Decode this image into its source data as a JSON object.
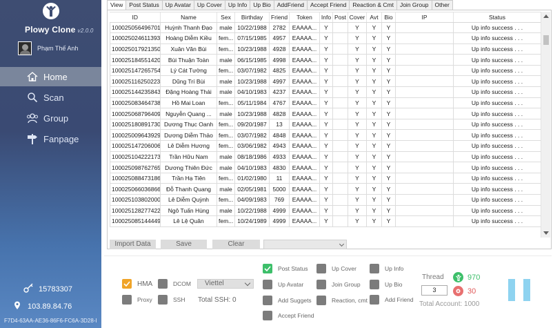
{
  "app": {
    "title": "Plowy Clone",
    "version": "v2.0.0",
    "user_name": "Phạm Thế Anh"
  },
  "nav": [
    {
      "label": "Home",
      "icon": "home-icon"
    },
    {
      "label": "Scan",
      "icon": "search-icon"
    },
    {
      "label": "Group",
      "icon": "group-icon"
    },
    {
      "label": "Fanpage",
      "icon": "signpost-icon"
    }
  ],
  "footer": {
    "key": "15783307",
    "ip": "103.89.84.76",
    "hwid": "F7D4-63AA-AE36-86F6-FC6A-3D28-I"
  },
  "tabs": [
    "View",
    "Post Status",
    "Up Avatar",
    "Up Cover",
    "Up Info",
    "Up Bio",
    "AddFriend",
    "Accept Friend",
    "Reaction & Cmt",
    "Join Group",
    "Other"
  ],
  "table": {
    "columns": [
      "ID",
      "Name",
      "Sex",
      "Birthday",
      "Friend",
      "Token",
      "Info",
      "Post",
      "Cover",
      "Avt",
      "Bio",
      "IP",
      "Status"
    ],
    "rows": [
      [
        "100025056496701",
        "Huỳnh Thanh Đạo",
        "male",
        "10/22/1988",
        "2782",
        "EAAAA...",
        "Y",
        "",
        "Y",
        "Y",
        "Y",
        "",
        "Up info success . . ."
      ],
      [
        "100025024611393",
        "Hoàng Diễm Kiều",
        "fem...",
        "07/15/1985",
        "4957",
        "EAAAA...",
        "Y",
        "",
        "Y",
        "Y",
        "Y",
        "",
        "Up info success . . ."
      ],
      [
        "100025017921350",
        "Xuân Văn Bùi",
        "fem...",
        "10/23/1988",
        "4928",
        "EAAAA...",
        "Y",
        "",
        "Y",
        "Y",
        "Y",
        "",
        "Up info success . . ."
      ],
      [
        "100025184551420",
        "Bùi Thuận Toàn",
        "male",
        "06/15/1985",
        "4998",
        "EAAAA...",
        "Y",
        "",
        "Y",
        "Y",
        "Y",
        "",
        "Up info success . . ."
      ],
      [
        "100025147265754",
        "Lý Cát Tường",
        "fem...",
        "03/07/1982",
        "4825",
        "EAAAA...",
        "Y",
        "",
        "Y",
        "Y",
        "Y",
        "",
        "Up info success . . ."
      ],
      [
        "100025116250223",
        "Dũng Trí Bùi",
        "male",
        "10/23/1988",
        "4997",
        "EAAAA...",
        "Y",
        "",
        "Y",
        "Y",
        "Y",
        "",
        "Up info success . . ."
      ],
      [
        "100025144235843",
        "Đặng Hoàng Thái",
        "male",
        "04/10/1983",
        "4237",
        "EAAAA...",
        "Y",
        "",
        "Y",
        "Y",
        "Y",
        "",
        "Up info success . . ."
      ],
      [
        "100025083464738",
        "Hồ Mai Loan",
        "fem...",
        "05/11/1984",
        "4767",
        "EAAAA...",
        "Y",
        "",
        "Y",
        "Y",
        "Y",
        "",
        "Up info success . . ."
      ],
      [
        "100025068796409",
        "Nguyễn Quang ...",
        "male",
        "10/23/1988",
        "4828",
        "EAAAA...",
        "Y",
        "",
        "Y",
        "Y",
        "Y",
        "",
        "Up info success . . ."
      ],
      [
        "100025180891730",
        "Dương Thục Oanh",
        "fem...",
        "09/20/1987",
        "13",
        "EAAAA...",
        "Y",
        "",
        "Y",
        "Y",
        "Y",
        "",
        "Up info success . . ."
      ],
      [
        "100025009643929",
        "Dương Diễm Thảo",
        "fem...",
        "03/07/1982",
        "4848",
        "EAAAA...",
        "Y",
        "",
        "Y",
        "Y",
        "Y",
        "",
        "Up info success . . ."
      ],
      [
        "100025147206006",
        "Lê Diễm Hương",
        "fem...",
        "03/06/1982",
        "4943",
        "EAAAA...",
        "Y",
        "",
        "Y",
        "Y",
        "Y",
        "",
        "Up info success . . ."
      ],
      [
        "100025104222173",
        "Trần Hữu Nam",
        "male",
        "08/18/1986",
        "4933",
        "EAAAA...",
        "Y",
        "",
        "Y",
        "Y",
        "Y",
        "",
        "Up info success . . ."
      ],
      [
        "100025098762765",
        "Dương Thiên Đức",
        "male",
        "04/10/1983",
        "4830",
        "EAAAA...",
        "Y",
        "",
        "Y",
        "Y",
        "Y",
        "",
        "Up info success . . ."
      ],
      [
        "100025088473186",
        "Trần Hạ Tiên",
        "fem...",
        "01/02/1980",
        "11",
        "EAAAA...",
        "Y",
        "",
        "Y",
        "Y",
        "Y",
        "",
        "Up info success . . ."
      ],
      [
        "100025066036866",
        "Đỗ Thanh Quang",
        "male",
        "02/05/1981",
        "5000",
        "EAAAA...",
        "Y",
        "",
        "Y",
        "Y",
        "Y",
        "",
        "Up info success . . ."
      ],
      [
        "100025103802000",
        "Lê Diễm Quỳnh",
        "fem...",
        "04/09/1983",
        "769",
        "EAAAA...",
        "Y",
        "",
        "Y",
        "Y",
        "Y",
        "",
        "Up info success . . ."
      ],
      [
        "100025128277422",
        "Ngô Tuấn Hùng",
        "male",
        "10/22/1988",
        "4999",
        "EAAAA...",
        "Y",
        "",
        "Y",
        "Y",
        "Y",
        "",
        "Up info success . . ."
      ],
      [
        "100025085144449",
        "Lê Lệ Quân",
        "fem...",
        "10/24/1989",
        "4999",
        "EAAAA...",
        "Y",
        "",
        "Y",
        "Y",
        "Y",
        "",
        "Up info success . . ."
      ]
    ]
  },
  "actions": {
    "import": "Import Data",
    "save": "Save",
    "clear": "Clear"
  },
  "options": {
    "hma": "HMA",
    "proxy": "Proxy",
    "dcom": "DCOM",
    "ssh": "SSH",
    "carrier": "Viettel",
    "total_ssh": "Total SSH: 0"
  },
  "tasks": {
    "post_status": "Post Status",
    "up_avatar": "Up Avatar",
    "add_suggets": "Add Suggets",
    "accept_friend": "Accept Friend",
    "up_cover": "Up Cover",
    "join_group": "Join Group",
    "reaction_cmt": "Reaction, cmt",
    "up_info": "Up Info",
    "up_bio": "Up Bio",
    "add_friend": "Add Friend"
  },
  "run": {
    "thread_label": "Thread",
    "thread_value": "3",
    "success_count": "970",
    "fail_count": "30",
    "total_account": "Total Account: 1000"
  },
  "colors": {
    "sidebar_top": "#3e4d72",
    "sidebar_bottom": "#5a88c3",
    "orange": "#f0a428",
    "green": "#3dbf6a",
    "pause": "#8ed3f0"
  }
}
